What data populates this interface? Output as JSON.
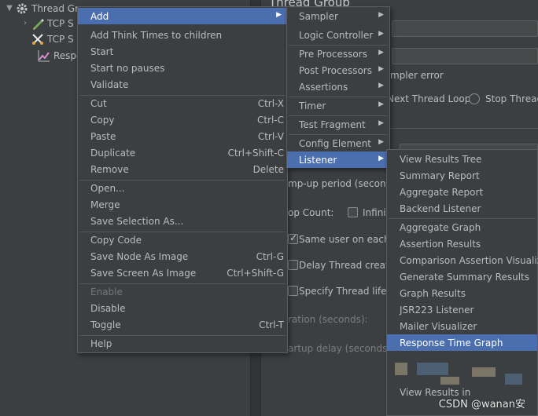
{
  "tree": {
    "items": [
      {
        "label": "Thread Gr",
        "icon": "gear-icon"
      },
      {
        "label": "TCP S",
        "icon": "pencil-icon"
      },
      {
        "label": "TCP S",
        "icon": "scissors-icon"
      },
      {
        "label": "Respo",
        "icon": "graph-icon"
      }
    ]
  },
  "panel": {
    "title": "Thread Group",
    "sampler_error_label": "mpler error",
    "next_thread_loop": "Next Thread Loop",
    "stop_thread": "Stop Thread",
    "ramp_up": "mp-up period (seconds",
    "loop_count": "op Count:",
    "infinite": "Infinit",
    "same_user": "Same user on each ite",
    "delay_thread": "Delay Thread creation",
    "specify_lifetime": "Specify Thread lifetim",
    "duration": "ration (seconds):",
    "startup_delay": "artup delay (seconds):"
  },
  "menu_main": {
    "add": "Add",
    "add_think_times": "Add Think Times to children",
    "start": "Start",
    "start_no_pauses": "Start no pauses",
    "validate": "Validate",
    "cut": "Cut",
    "cut_key": "Ctrl-X",
    "copy": "Copy",
    "copy_key": "Ctrl-C",
    "paste": "Paste",
    "paste_key": "Ctrl-V",
    "duplicate": "Duplicate",
    "duplicate_key": "Ctrl+Shift-C",
    "remove": "Remove",
    "remove_key": "Delete",
    "open": "Open...",
    "merge": "Merge",
    "save_selection": "Save Selection As...",
    "copy_code": "Copy Code",
    "save_node_image": "Save Node As Image",
    "save_node_image_key": "Ctrl-G",
    "save_screen_image": "Save Screen As Image",
    "save_screen_image_key": "Ctrl+Shift-G",
    "enable": "Enable",
    "disable": "Disable",
    "toggle": "Toggle",
    "toggle_key": "Ctrl-T",
    "help": "Help"
  },
  "menu_add": {
    "sampler": "Sampler",
    "logic_controller": "Logic Controller",
    "pre_processors": "Pre Processors",
    "post_processors": "Post Processors",
    "assertions": "Assertions",
    "timer": "Timer",
    "test_fragment": "Test Fragment",
    "config_element": "Config Element",
    "listener": "Listener"
  },
  "menu_listener": {
    "items": [
      "View Results Tree",
      "Summary Report",
      "Aggregate Report",
      "Backend Listener",
      "Aggregate Graph",
      "Assertion Results",
      "Comparison Assertion Visualizer",
      "Generate Summary Results",
      "Graph Results",
      "JSR223 Listener",
      "Mailer Visualizer",
      "Response Time Graph",
      "View Results in"
    ]
  },
  "watermark": "CSDN @wanan安",
  "colors": {
    "selection": "#4b6eaf",
    "menu_bg": "#3c3f41",
    "text": "#bbbbbb"
  }
}
